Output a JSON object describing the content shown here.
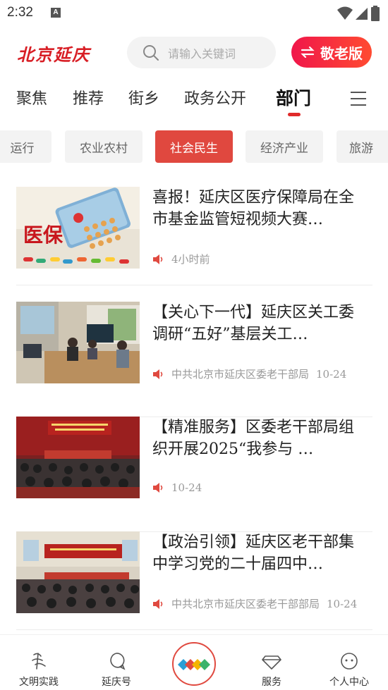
{
  "status_bar": {
    "time": "2:32",
    "notification_badge": "A"
  },
  "header": {
    "logo": "北京延庆",
    "search_placeholder": "请输入关键词",
    "elder_mode_label": "敬老版",
    "brand_color": "#d81e25"
  },
  "tabs": [
    {
      "label": "聚焦",
      "active": false
    },
    {
      "label": "推荐",
      "active": false
    },
    {
      "label": "街乡",
      "active": false
    },
    {
      "label": "政务公开",
      "active": false
    },
    {
      "label": "部门",
      "active": true
    }
  ],
  "subtabs": [
    {
      "label": "运行",
      "active": false
    },
    {
      "label": "农业农村",
      "active": false
    },
    {
      "label": "社会民生",
      "active": true
    },
    {
      "label": "经济产业",
      "active": false
    },
    {
      "label": "旅游",
      "active": false
    }
  ],
  "news": [
    {
      "title": "喜报！延庆区医疗保障局在全市基金监管短视频大赛…",
      "source": "",
      "time": "4小时前",
      "thumb_icon": "medical-insurance-image",
      "thumb_text": "医保"
    },
    {
      "title": "【关心下一代】延庆区关工委调研“五好”基层关工…",
      "source": "中共北京市延庆区委老干部局",
      "time": "10-24",
      "thumb_icon": "meeting-room-photo"
    },
    {
      "title": "【精准服务】区委老干部局组织开展2025“我参与 …",
      "source": "",
      "time": "10-24",
      "thumb_icon": "auditorium-photo"
    },
    {
      "title": "【政治引领】延庆区老干部集中学习党的二十届四中…",
      "source": "中共北京市延庆区委老干部部局",
      "time": "10-24",
      "thumb_icon": "auditorium-photo"
    }
  ],
  "bottom_nav": [
    {
      "label": "文明实践",
      "icon": "civilization-icon"
    },
    {
      "label": "延庆号",
      "icon": "chat-icon"
    },
    {
      "label": "",
      "icon": "home-logo-icon"
    },
    {
      "label": "服务",
      "icon": "diamond-icon"
    },
    {
      "label": "个人中心",
      "icon": "face-icon"
    }
  ]
}
